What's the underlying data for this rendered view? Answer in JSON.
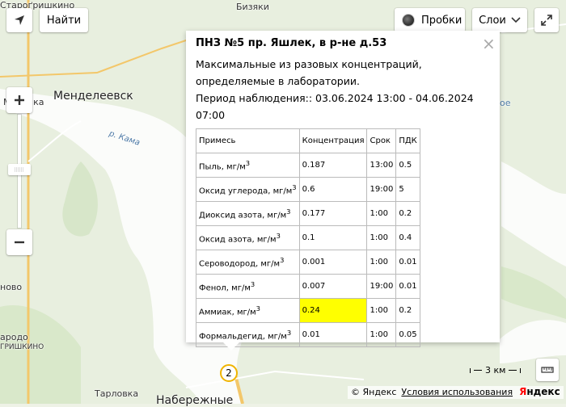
{
  "toolbar": {
    "find_label": "Найти",
    "traffic_label": "Пробки",
    "layers_label": "Слои"
  },
  "map_labels": {
    "mendeleevsk": "Менделеевск",
    "kama_river": "р. Кама",
    "tarlovka": "Тарловка",
    "naberezhnye": "Набережные",
    "top_left": "Староґришкино",
    "left_mid": "Мунайка",
    "left_novo": "ново",
    "left_rodo": "ародо",
    "left_grishkino": "ГРИШКИНО",
    "top_center": "Бизяки",
    "right_ove": "ое"
  },
  "balloon": {
    "title": "ПНЗ №5 пр. Яшлек, в р-не д.53",
    "line1": "Максимальные из разовых концентраций,",
    "line2": "определяемые в лаборатории.",
    "period": "Период наблюдения:: 03.06.2024 13:00 - 04.06.2024 07:00",
    "close_symbol": "×",
    "table": {
      "headers": [
        "Примесь",
        "Концентрация",
        "Срок",
        "ПДК"
      ],
      "rows": [
        {
          "name": "Пыль, мг/м",
          "conc": "0.187",
          "time": "13:00",
          "pdk": "0.5"
        },
        {
          "name": "Оксид углерода, мг/м",
          "conc": "0.6",
          "time": "19:00",
          "pdk": "5"
        },
        {
          "name": "Диоксид азота, мг/м",
          "conc": "0.177",
          "time": "1:00",
          "pdk": "0.2"
        },
        {
          "name": "Оксид азота, мг/м",
          "conc": "0.1",
          "time": "1:00",
          "pdk": "0.4"
        },
        {
          "name": "Сероводород, мг/м",
          "conc": "0.001",
          "time": "1:00",
          "pdk": "0.01"
        },
        {
          "name": "Фенол, мг/м",
          "conc": "0.007",
          "time": "19:00",
          "pdk": "0.01"
        },
        {
          "name": "Аммиак, мг/м",
          "conc": "0.24",
          "time": "1:00",
          "pdk": "0.2"
        },
        {
          "name": "Формальдегид, мг/м",
          "conc": "0.01",
          "time": "1:00",
          "pdk": "0.05"
        }
      ],
      "unit_superscript": "3",
      "highlight_row": 6,
      "highlight_color": "#ffff00"
    }
  },
  "marker_label": "2",
  "scale_label": "3 км",
  "copyright": {
    "text": "© Яндекс",
    "terms": "Условия использования",
    "logo_first": "Я",
    "logo_rest": "ндекс"
  },
  "colors": {
    "water": "#fcfdfc",
    "land": "#e7efde",
    "river_water": "#ffffff",
    "road": "#f5c96a",
    "marker_ring": "#f0b400"
  }
}
